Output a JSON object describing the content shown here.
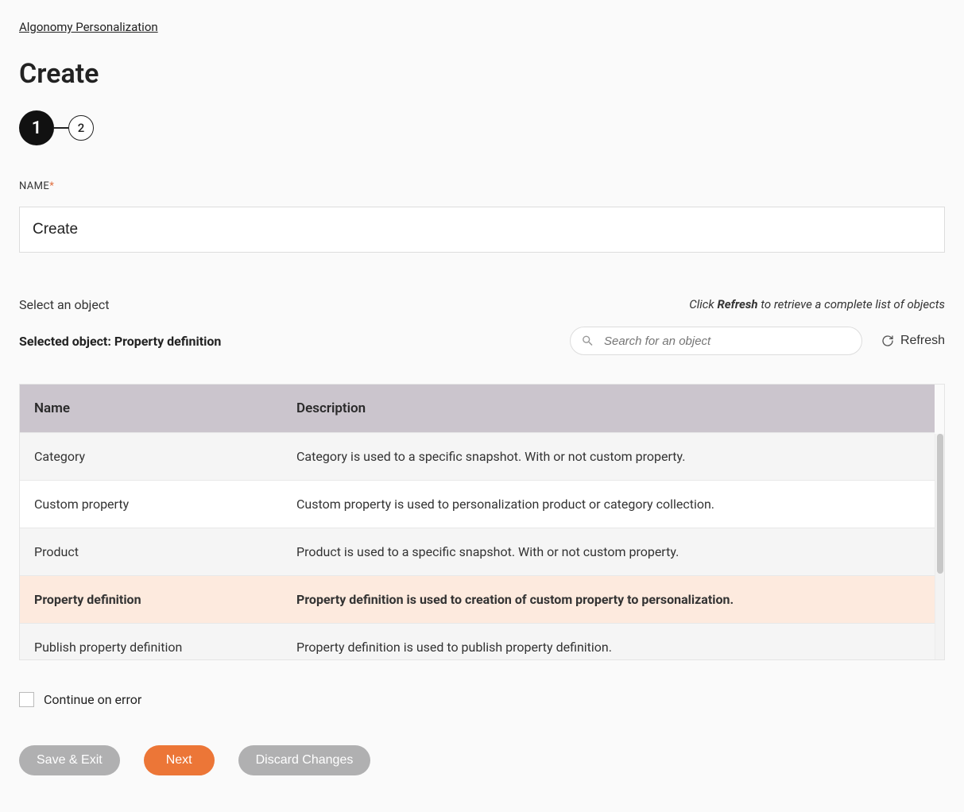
{
  "breadcrumb": "Algonomy Personalization",
  "page_title": "Create",
  "stepper": {
    "step1": "1",
    "step2": "2"
  },
  "name_field": {
    "label": "NAME",
    "value": "Create"
  },
  "object_section": {
    "select_text": "Select an object",
    "refresh_hint_prefix": "Click ",
    "refresh_hint_bold": "Refresh",
    "refresh_hint_suffix": " to retrieve a complete list of objects",
    "selected_prefix": "Selected object: ",
    "selected_value": "Property definition",
    "search_placeholder": "Search for an object",
    "refresh_button": "Refresh"
  },
  "table": {
    "headers": {
      "name": "Name",
      "description": "Description"
    },
    "rows": [
      {
        "name": "Category",
        "description": "Category is used to a specific snapshot. With or not custom property."
      },
      {
        "name": "Custom property",
        "description": "Custom property is used to personalization product or category collection."
      },
      {
        "name": "Product",
        "description": "Product is used to a specific snapshot. With or not custom property."
      },
      {
        "name": "Property definition",
        "description": "Property definition is used to creation of custom property to personalization."
      },
      {
        "name": "Publish property definition",
        "description": "Property definition is used to publish property definition."
      }
    ],
    "selected_index": 3
  },
  "checkbox": {
    "label": "Continue on error"
  },
  "buttons": {
    "save_exit": "Save & Exit",
    "next": "Next",
    "discard": "Discard Changes"
  }
}
